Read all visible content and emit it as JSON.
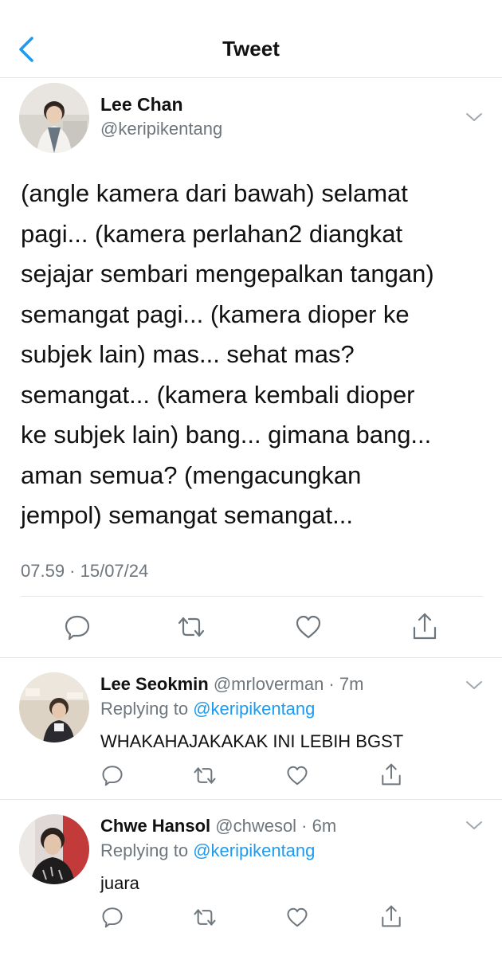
{
  "header": {
    "title": "Tweet",
    "back_icon": "chevron-left-icon",
    "accent_color": "#1d9bf0"
  },
  "main_tweet": {
    "name": "Lee Chan",
    "handle": "@keripikentang",
    "text_lines": [
      "(angle kamera dari bawah) selamat",
      "pagi... (kamera perlahan2 diangkat",
      "sejajar sembari mengepalkan tangan)",
      "semangat pagi... (kamera dioper ke",
      "subjek lain) mas... sehat mas?",
      "semangat... (kamera kembali dioper",
      "ke subjek lain) bang... gimana bang...",
      "aman semua? (mengacungkan",
      "jempol) semangat semangat..."
    ],
    "timestamp": "07.59 · 15/07/24",
    "actions": [
      "reply-icon",
      "retweet-icon",
      "like-icon",
      "share-icon"
    ]
  },
  "replies": [
    {
      "name": "Lee Seokmin",
      "meta": " @mrloverman · 7m",
      "replying_prefix": "Replying to ",
      "replying_handle": "@keripikentang",
      "text": "WHAKAHAJAKAKAK INI LEBIH BGST"
    },
    {
      "name": "Chwe Hansol",
      "meta": " @chwesol · 6m",
      "replying_prefix": "Replying to ",
      "replying_handle": "@keripikentang",
      "text": "juara"
    }
  ]
}
